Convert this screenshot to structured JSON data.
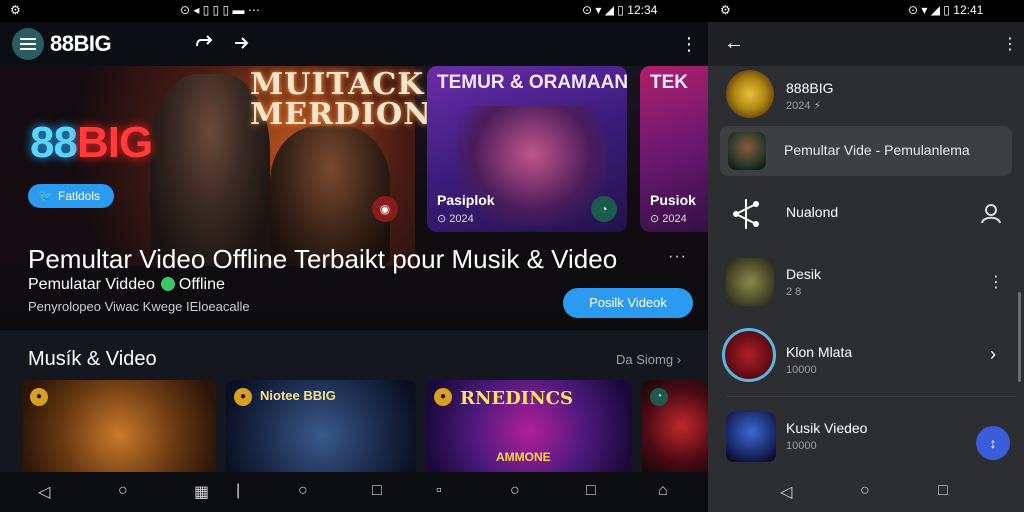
{
  "status": {
    "left_icons": "⚙",
    "mid_icons": "⊙ ◂ ▯ ▯ ▯ ▬ ⋯",
    "right_icons_1": "⊙ ▾ ◢ ▯",
    "time_1": "12:34",
    "right_icons_2": "⚙",
    "right_icons_3": "⊙ ▾ ◢ ▯",
    "time_2": "12:41"
  },
  "appbar": {
    "brand": "88BIG",
    "share_icon": "share-icon",
    "forward_icon": "forward-icon"
  },
  "hero": {
    "logo_part_a": "88",
    "logo_part_b": "BIG",
    "twitter_label": "Fatldols",
    "poster_title": "MUITACK MERDION",
    "title": "Pemultar Video Offline Terbaikt pour Musik & Video",
    "more": "···",
    "subtitle_text": "Pemulatar Viddeo",
    "subtitle_badge": "Offline",
    "description": "Penyrolopeo Viwac Kwege IEloeacalle",
    "cta": "Posilk Videok"
  },
  "cards": [
    {
      "title": "TEMUR & ORAMAAN",
      "sub": "Pasiplok",
      "meta": "⊙ 2024"
    },
    {
      "title": "TEK",
      "sub": "Pusiok",
      "meta": "⊙ 2024"
    }
  ],
  "section": {
    "title": "Musík & Video",
    "link": "Da Siomg"
  },
  "thumbs": [
    {
      "title": ""
    },
    {
      "title": "Niotee BBIG"
    },
    {
      "title": "RNEDINCS",
      "sub": "AMMONE"
    },
    {
      "title": ""
    }
  ],
  "right_panel": {
    "items": [
      {
        "name": "888BIG",
        "sub": "2024 ⚡"
      },
      {
        "name": "Pemultar Vide - Pemulanlema"
      },
      {
        "name": "Nualond"
      },
      {
        "name": "Desik",
        "sub": "2 8"
      },
      {
        "name": "Klon Mlata",
        "sub": "10000"
      },
      {
        "name": "Kusik Viedeo",
        "sub": "10000"
      }
    ]
  },
  "colors": {
    "accent": "#2a9bf0",
    "fab": "#3b5ddc",
    "brand_blue": "#5bd6ff",
    "brand_red": "#ff3b3b"
  }
}
